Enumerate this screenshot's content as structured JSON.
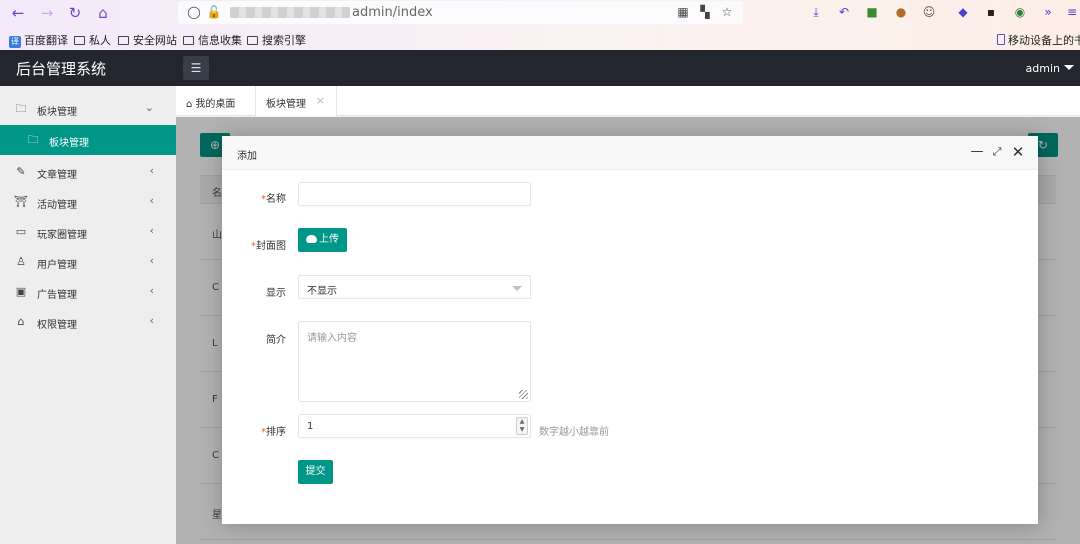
{
  "browser": {
    "url_suffix": "admin/index",
    "bookmarks": [
      "百度翻译",
      "私人",
      "安全网站",
      "信息收集",
      "搜索引擎"
    ],
    "mobile_bookmarks": "移动设备上的书签"
  },
  "header": {
    "title": "后台管理系统",
    "user": "admin"
  },
  "sidebar": {
    "items": [
      {
        "label": "板块管理",
        "icon": "folder-icon",
        "expanded": true
      },
      {
        "label": "板块管理",
        "icon": "folder-icon",
        "active": true
      },
      {
        "label": "文章管理",
        "icon": "edit-icon"
      },
      {
        "label": "活动管理",
        "icon": "gift-icon"
      },
      {
        "label": "玩家圈管理",
        "icon": "video-icon"
      },
      {
        "label": "用户管理",
        "icon": "user-icon"
      },
      {
        "label": "广告管理",
        "icon": "image-icon"
      },
      {
        "label": "权限管理",
        "icon": "lock-icon"
      }
    ]
  },
  "tabs": {
    "home": "我的桌面",
    "active": "板块管理"
  },
  "background_table": {
    "header": "名",
    "rows": [
      "山",
      "C",
      "L",
      "F",
      "C",
      "星"
    ]
  },
  "modal": {
    "title": "添加",
    "fields": {
      "name_label": "名称",
      "cover_label": "封面图",
      "upload_button": "上传",
      "display_label": "显示",
      "display_value": "不显示",
      "intro_label": "简介",
      "intro_placeholder": "请输入内容",
      "sort_label": "排序",
      "sort_value": "1",
      "sort_hint": "数字越小越靠前",
      "submit_button": "提交"
    },
    "required_color": "#ff5722"
  },
  "colors": {
    "accent": "#009688",
    "header_bg": "#23262e"
  }
}
